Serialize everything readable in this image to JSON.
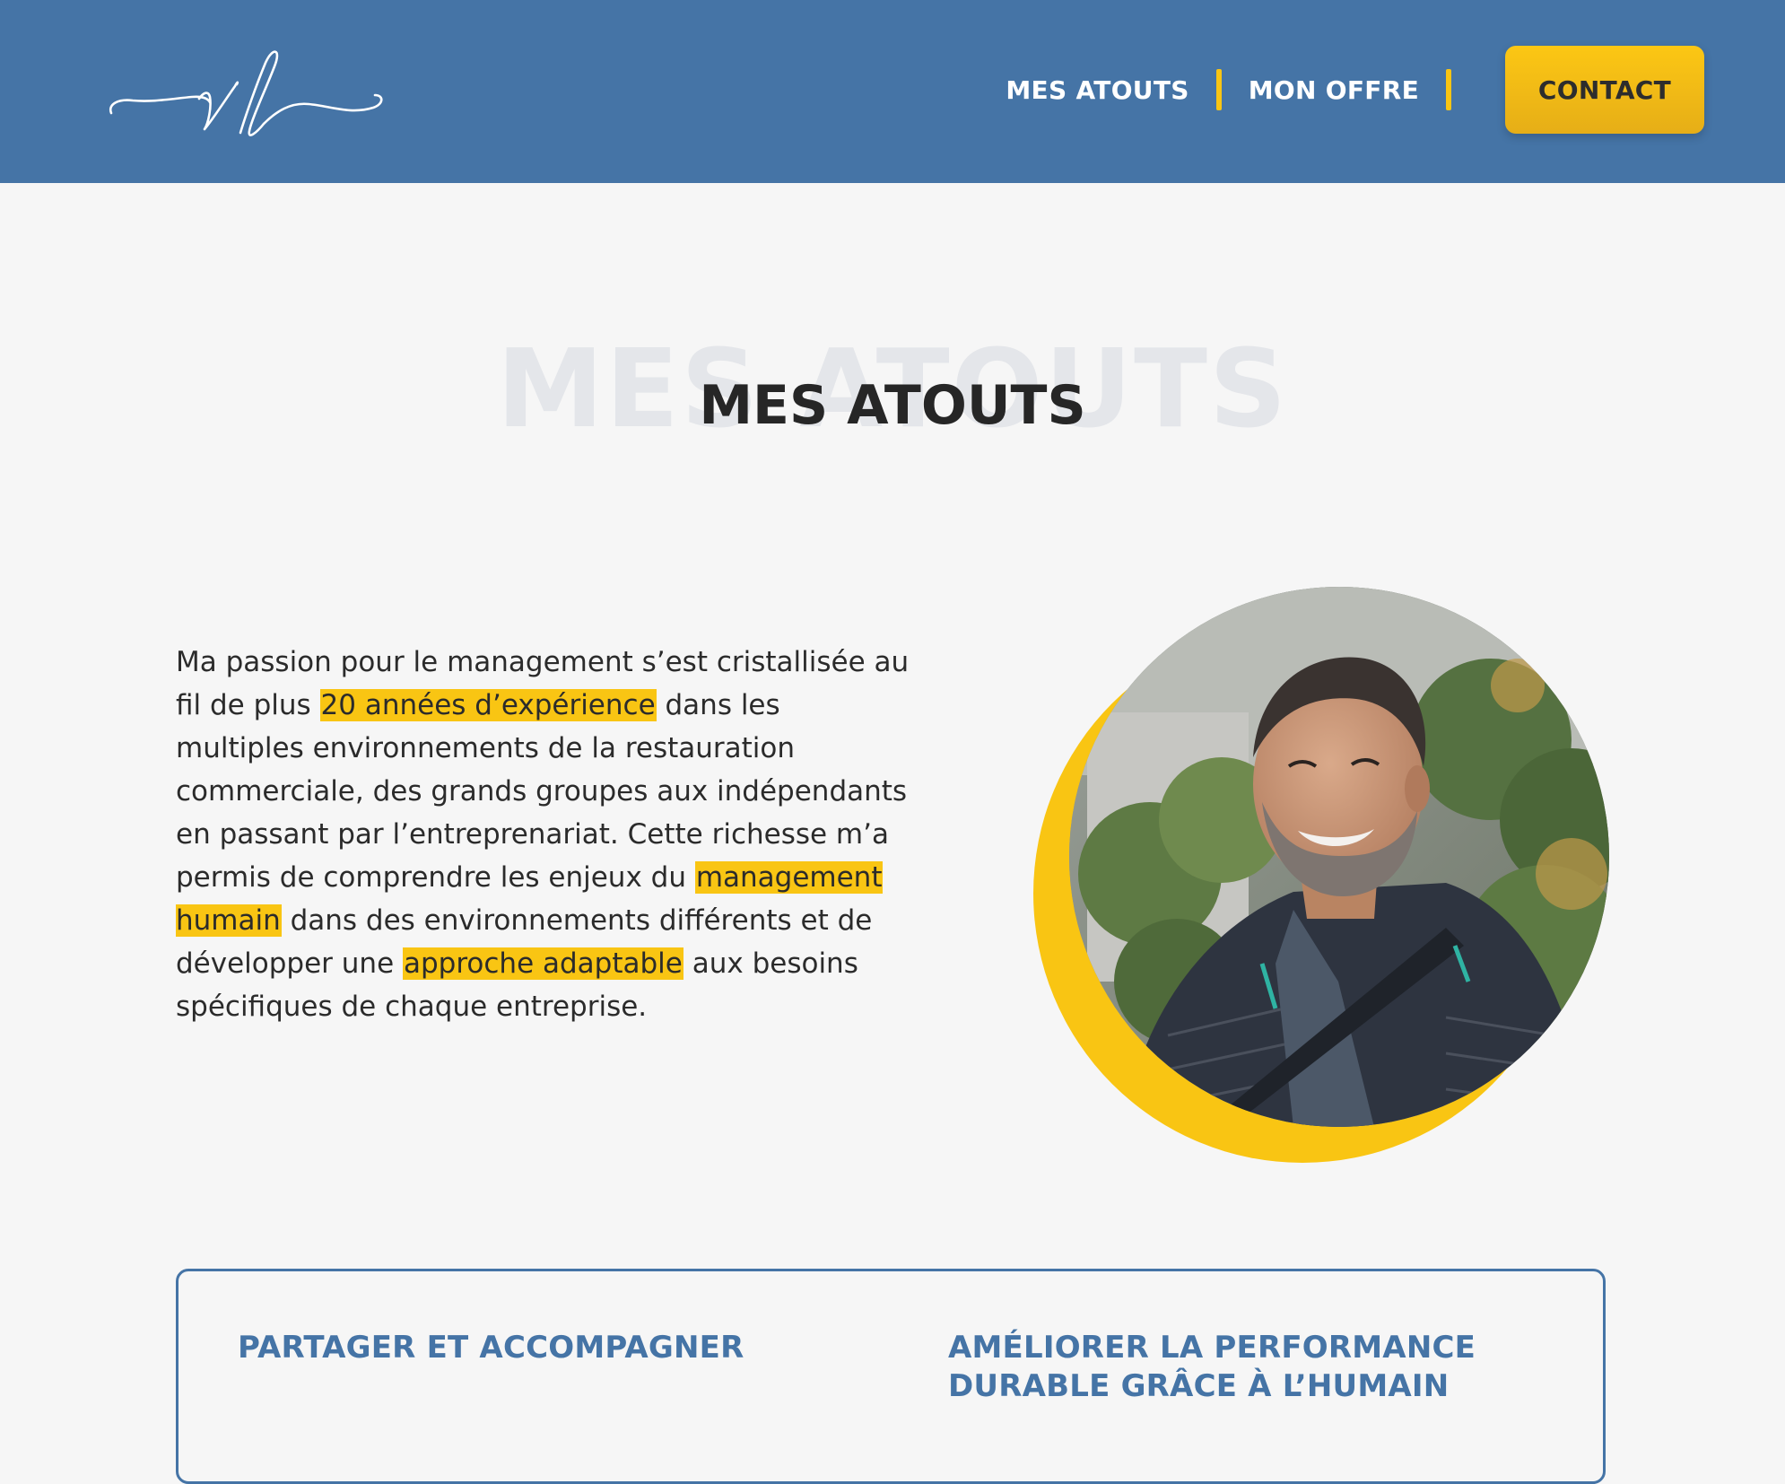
{
  "header": {
    "logo_text": "vl",
    "nav": {
      "item_1": "MES ATOUTS",
      "item_2": "MON OFFRE",
      "contact": "CONTACT"
    }
  },
  "section": {
    "ghost_title": "MES ATOUTS",
    "title": "MES ATOUTS",
    "intro": {
      "part_1": "Ma passion pour le management s’est cristallisée au fil de plus ",
      "highlight_1": "20 années d’expérience",
      "part_2": " dans les multiples environnements de la restauration commerciale, des grands groupes aux indépendants en passant par l’entreprenariat. Cette richesse m’a permis de comprendre les enjeux du ",
      "highlight_2": "management humain",
      "part_3": " dans des environnements différents et de développer une ",
      "highlight_3": "approche adaptable",
      "part_4": " aux besoins spécifiques de chaque entreprise."
    }
  },
  "card": {
    "heading_left": "PARTAGER ET ACCOMPAGNER",
    "heading_right": "AMÉLIORER LA PERFORMANCE DURABLE GRÂCE À L’HUMAIN"
  },
  "colors": {
    "header_bg": "#4574a6",
    "accent_yellow": "#f9c513",
    "page_bg": "#f6f6f6",
    "heading_dark": "#262626",
    "card_blue": "#4574a6"
  }
}
